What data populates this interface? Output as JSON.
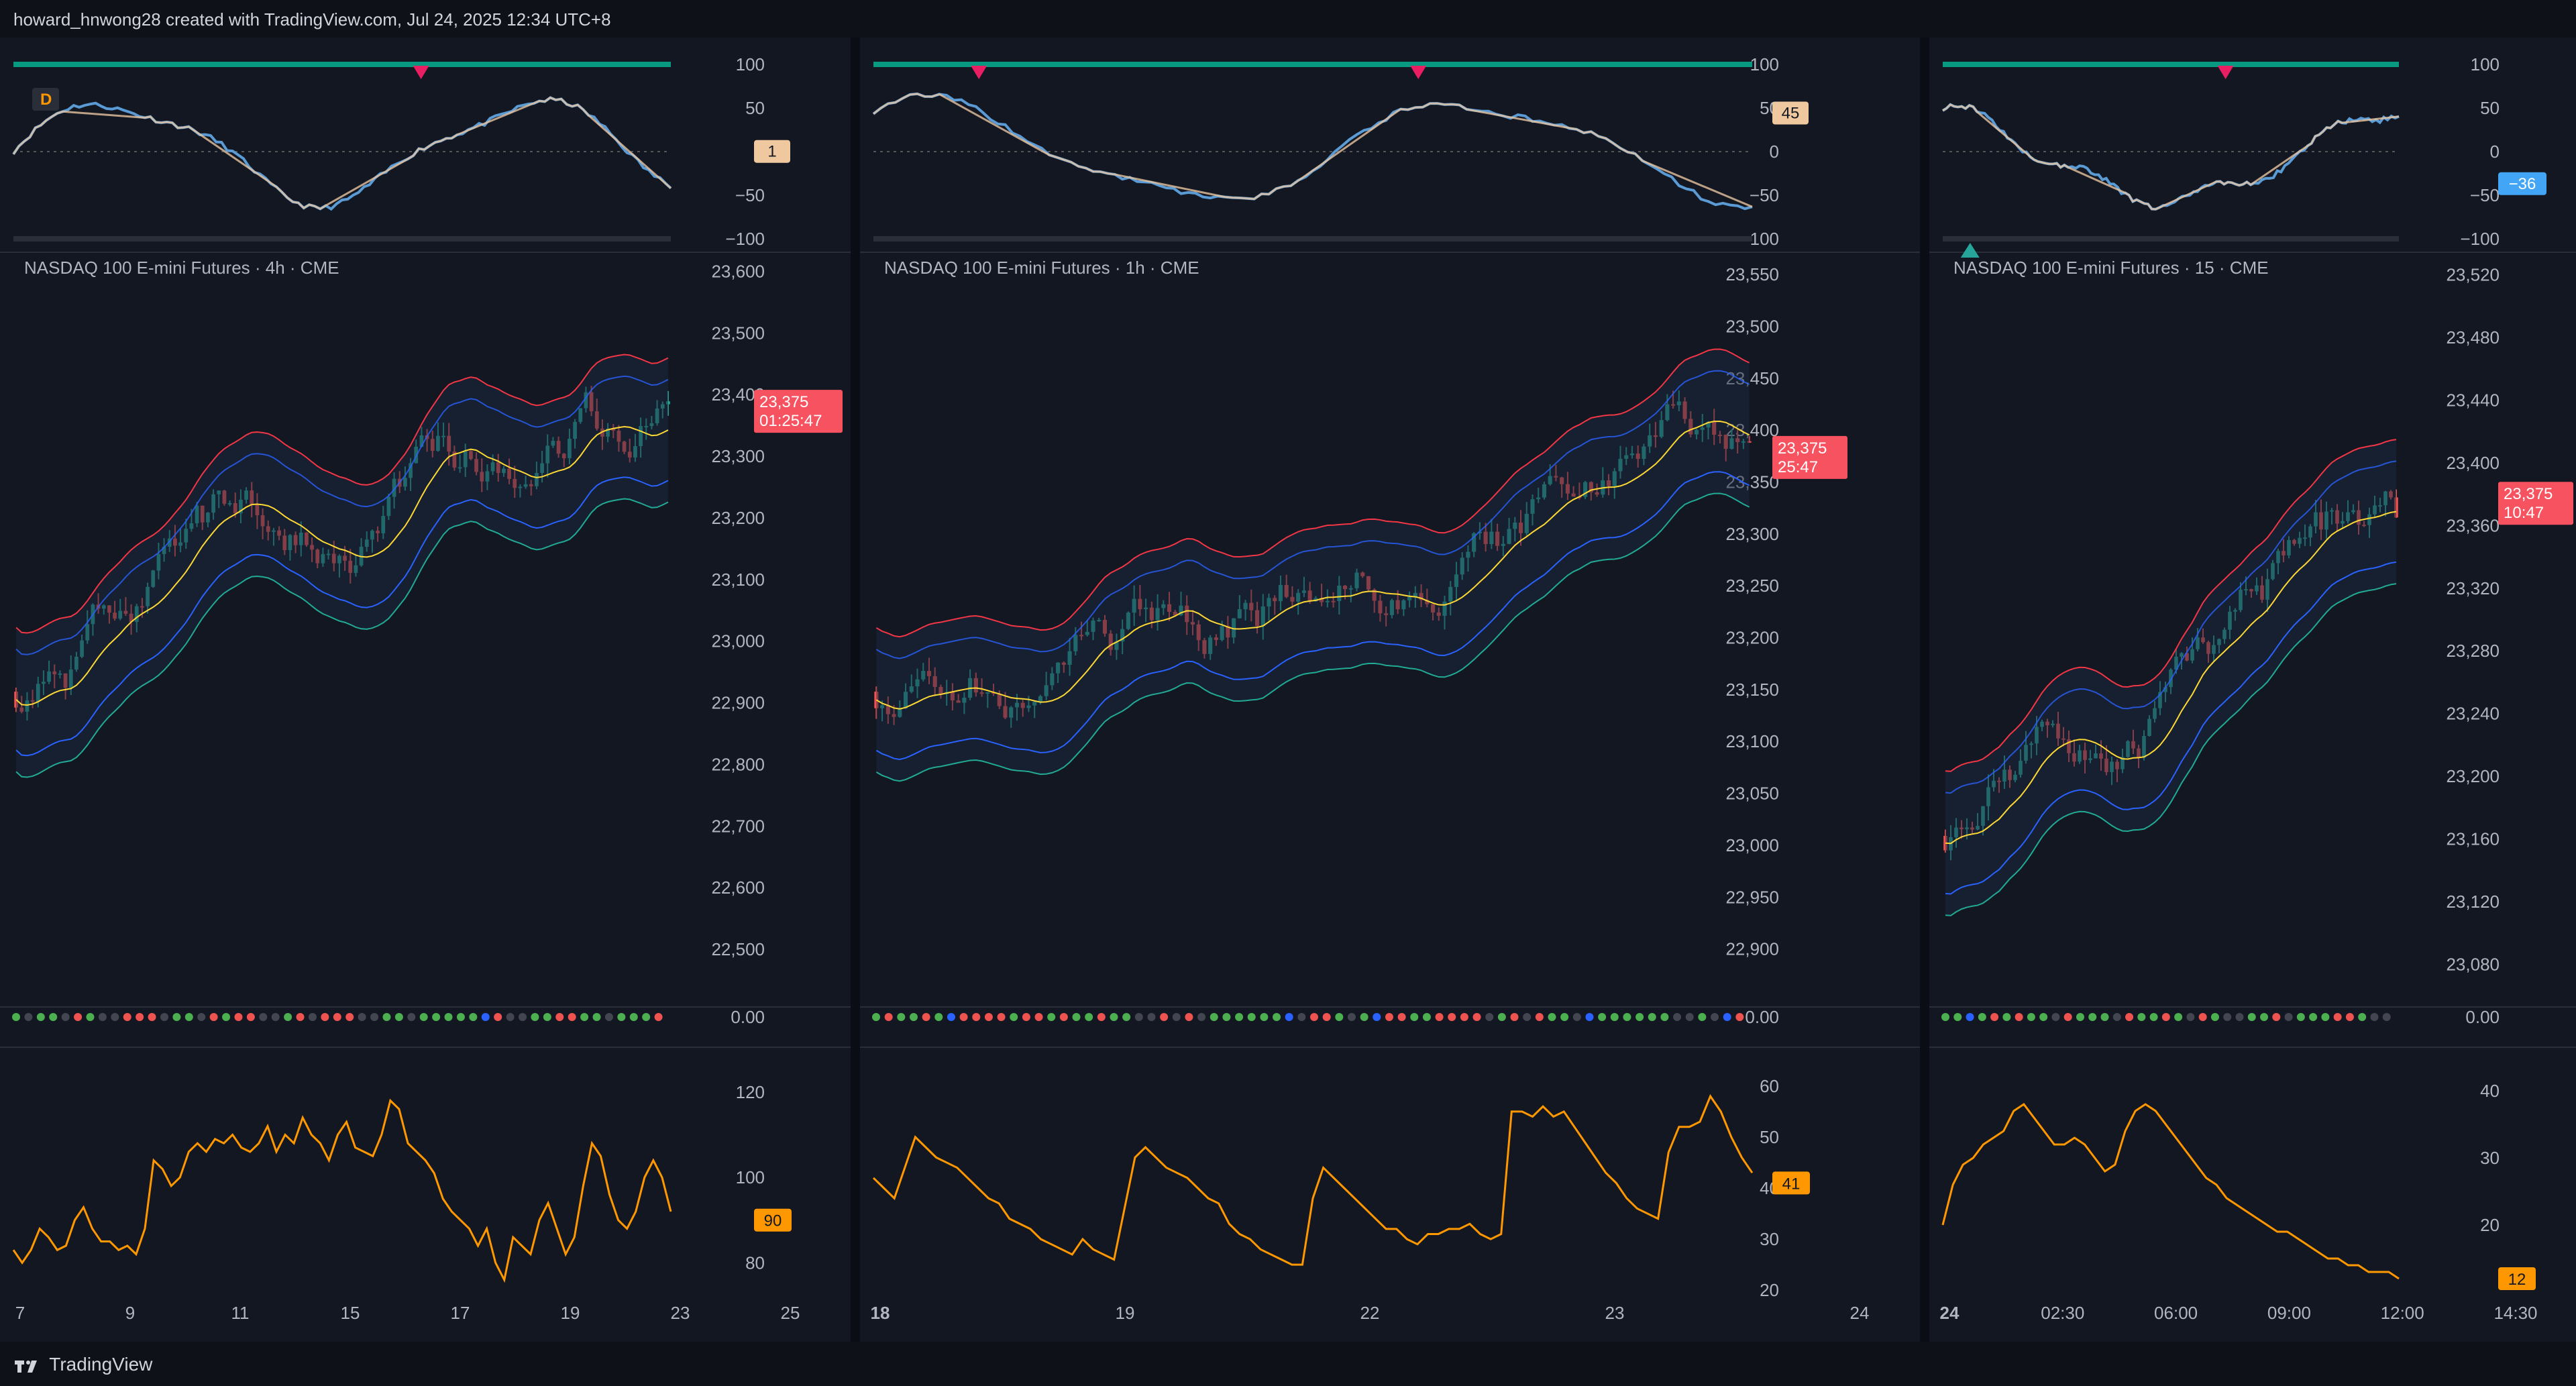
{
  "header": {
    "text": "howard_hnwong28 created with TradingView.com, Jul 24, 2025 12:34 UTC+8"
  },
  "footer": {
    "brand": "TradingView"
  },
  "colors": {
    "bg": "#131722",
    "grid": "#1e2230",
    "text": "#b2b5be",
    "up": "#26a69a",
    "down": "#ef5350",
    "bb_upper": "#f23645",
    "bb_lower": "#22ab94",
    "bb_fill": "#1b2a3d",
    "ma_yellow": "#fdd835",
    "ma_blue": "#2962ff",
    "wave_blue": "#5b9bd5",
    "wave_tan": "#e8c4a0",
    "vol_line": "#ff9800",
    "price_label": "#f7525f",
    "accent_orange": "#ff9800"
  },
  "chart_data": [
    {
      "title": "NASDAQ 100 E-mini Futures · 4h · CME",
      "type": "candlestick",
      "timeframe": "4h",
      "current_price": "23,375",
      "countdown": "01:25:47",
      "price_axis": [
        "23,600",
        "23,500",
        "23,400",
        "23,300",
        "23,200",
        "23,100",
        "23,000",
        "22,900",
        "22,800",
        "22,700",
        "22,600",
        "22,500"
      ],
      "price_range": [
        22450,
        23620
      ],
      "x_labels": [
        "7",
        "9",
        "11",
        "15",
        "17",
        "19",
        "23",
        "25"
      ],
      "oscillator": {
        "axis": [
          "100",
          "50",
          "0",
          "−50",
          "−100"
        ],
        "value": "1",
        "value_color": "#f0c8a0",
        "badge": "D"
      },
      "dots_value": "0.00",
      "volatility": {
        "axis": [
          "120",
          "100",
          "80"
        ],
        "value": "90",
        "range": [
          70,
          125
        ],
        "values": [
          83,
          80,
          83,
          88,
          86,
          83,
          84,
          90,
          93,
          88,
          85,
          85,
          83,
          84,
          82,
          88,
          104,
          102,
          98,
          100,
          106,
          108,
          106,
          109,
          108,
          110,
          107,
          106,
          108,
          112,
          106,
          110,
          108,
          114,
          110,
          108,
          104,
          110,
          113,
          107,
          106,
          105,
          110,
          118,
          116,
          108,
          106,
          104,
          101,
          95,
          92,
          90,
          88,
          84,
          88,
          80,
          76,
          86,
          84,
          82,
          90,
          94,
          88,
          82,
          86,
          98,
          108,
          105,
          96,
          90,
          88,
          92,
          100,
          104,
          100,
          92
        ]
      }
    },
    {
      "title": "NASDAQ 100 E-mini Futures · 1h · CME",
      "type": "candlestick",
      "timeframe": "1h",
      "current_price": "23,375",
      "countdown": "25:47",
      "price_axis": [
        "23,550",
        "23,500",
        "23,450",
        "23,400",
        "23,350",
        "23,300",
        "23,250",
        "23,200",
        "23,150",
        "23,100",
        "23,050",
        "23,000",
        "22,950",
        "22,900"
      ],
      "price_range": [
        22870,
        23565
      ],
      "x_labels": [
        "18",
        "19",
        "22",
        "23",
        "24"
      ],
      "oscillator": {
        "axis": [
          "100",
          "50",
          "0",
          "−50",
          "−100"
        ],
        "value": "45",
        "value_color": "#f0c8a0"
      },
      "dots_value": "0.00",
      "volatility": {
        "axis": [
          "60",
          "50",
          "40",
          "30",
          "20"
        ],
        "value": "41",
        "range": [
          17,
          63
        ],
        "values": [
          42,
          40,
          38,
          44,
          50,
          48,
          46,
          45,
          44,
          42,
          40,
          38,
          37,
          34,
          33,
          32,
          30,
          29,
          28,
          27,
          30,
          28,
          27,
          26,
          36,
          46,
          48,
          46,
          44,
          43,
          42,
          40,
          38,
          37,
          33,
          31,
          30,
          28,
          27,
          26,
          25,
          25,
          38,
          44,
          42,
          40,
          38,
          36,
          34,
          32,
          32,
          30,
          29,
          31,
          31,
          32,
          32,
          33,
          31,
          30,
          31,
          55,
          55,
          54,
          56,
          54,
          55,
          52,
          49,
          46,
          43,
          41,
          38,
          36,
          35,
          34,
          47,
          52,
          52,
          53,
          58,
          55,
          50,
          46,
          43
        ]
      }
    },
    {
      "title": "NASDAQ 100 E-mini Futures · 15 · CME",
      "type": "candlestick",
      "timeframe": "15",
      "current_price": "23,375",
      "countdown": "10:47",
      "price_axis": [
        "23,520",
        "23,480",
        "23,440",
        "23,400",
        "23,360",
        "23,320",
        "23,280",
        "23,240",
        "23,200",
        "23,160",
        "23,120",
        "23,080"
      ],
      "price_range": [
        23070,
        23530
      ],
      "x_labels": [
        "24",
        "02:30",
        "06:00",
        "09:00",
        "12:00",
        "14:30"
      ],
      "oscillator": {
        "axis": [
          "100",
          "50",
          "0",
          "−50",
          "−100"
        ],
        "value": "−36",
        "value_color": "#42a5f5"
      },
      "dots_value": "0.00",
      "volatility": {
        "axis": [
          "40",
          "30",
          "20"
        ],
        "value": "12",
        "range": [
          8,
          43
        ],
        "values": [
          20,
          26,
          29,
          30,
          32,
          33,
          34,
          37,
          38,
          36,
          34,
          32,
          32,
          33,
          32,
          30,
          28,
          29,
          34,
          37,
          38,
          37,
          35,
          33,
          31,
          29,
          27,
          26,
          24,
          23,
          22,
          21,
          20,
          19,
          19,
          18,
          17,
          16,
          15,
          15,
          14,
          14,
          13,
          13,
          13,
          12
        ]
      }
    }
  ]
}
